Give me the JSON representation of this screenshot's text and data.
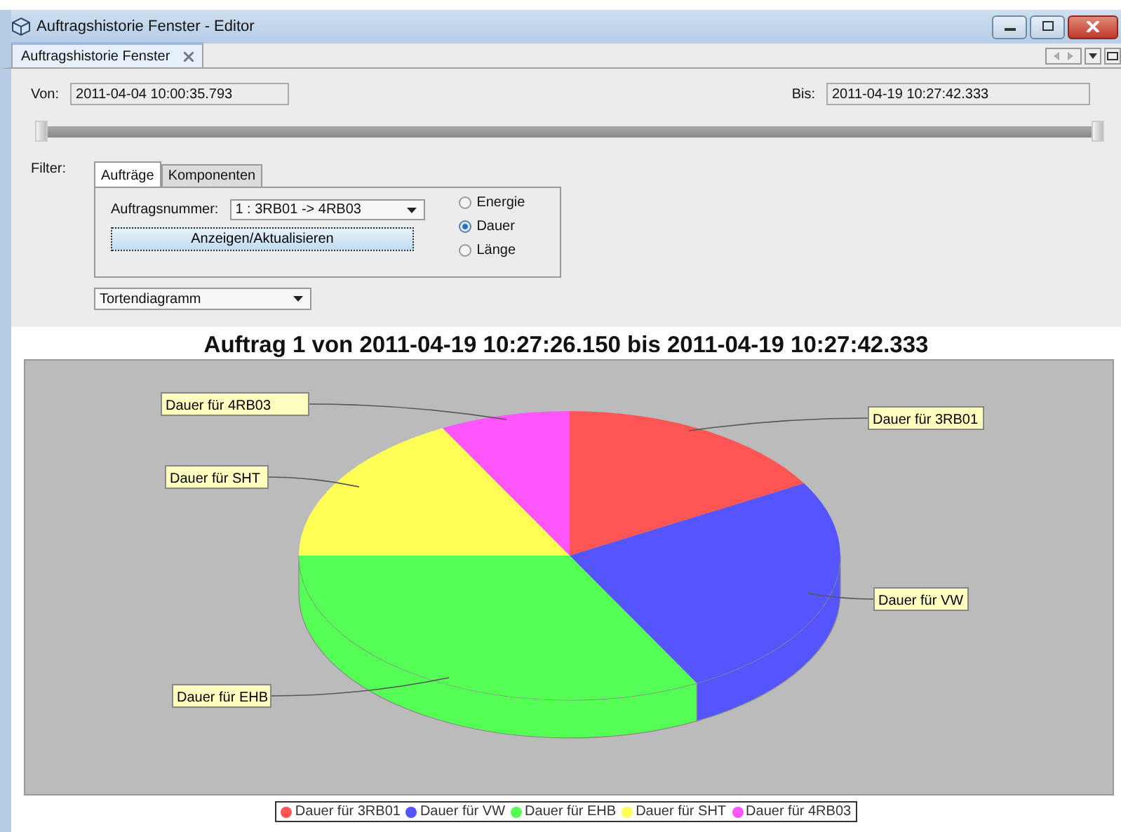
{
  "window": {
    "title": "Auftragshistorie Fenster - Editor"
  },
  "tabs": [
    {
      "label": "Auftragshistorie Fenster",
      "selected": true
    }
  ],
  "range": {
    "from_label": "Von:",
    "from_value": "2011-04-04 10:00:35.793",
    "to_label": "Bis:",
    "to_value": "2011-04-19 10:27:42.333"
  },
  "slider": {
    "thumbs": [
      {
        "level": 0
      },
      {
        "level": 1
      }
    ]
  },
  "filter": {
    "label": "Filter:",
    "tabs": [
      {
        "label": "Aufträge",
        "selected": true
      },
      {
        "label": "Komponenten",
        "selected": false
      }
    ],
    "order_label": "Auftragsnummer:",
    "order_value": "1 : 3RB01 -> 4RB03",
    "button": "Anzeigen/Aktualisieren",
    "measures": [
      {
        "label": "Energie",
        "selected": false
      },
      {
        "label": "Dauer",
        "selected": true
      },
      {
        "label": "Länge",
        "selected": false
      }
    ]
  },
  "chart_type": "Tortendiagramm",
  "chart": {
    "title": "Auftrag 1 von 2011-04-19 10:27:26.150 bis 2011-04-19 10:27:42.333",
    "slices": [
      {
        "label": "Dauer für 4RB03",
        "color": "#ff55ff"
      },
      {
        "label": "Dauer für 3RB01",
        "color": "#ff5555"
      },
      {
        "label": "Dauer für SHT",
        "color": "#ffff55"
      },
      {
        "label": "Dauer für VW",
        "color": "#5555ff"
      },
      {
        "label": "Dauer für EHB",
        "color": "#55ff55"
      }
    ],
    "legend": [
      {
        "label": "Dauer für 3RB01",
        "color": "#ff5555"
      },
      {
        "label": "Dauer für VW",
        "color": "#5555ff"
      },
      {
        "label": "Dauer für EHB",
        "color": "#55ff55"
      },
      {
        "label": "Dauer für SHT",
        "color": "#ffff55"
      },
      {
        "label": "Dauer für 4RB03",
        "color": "#ff55ff"
      }
    ]
  }
}
